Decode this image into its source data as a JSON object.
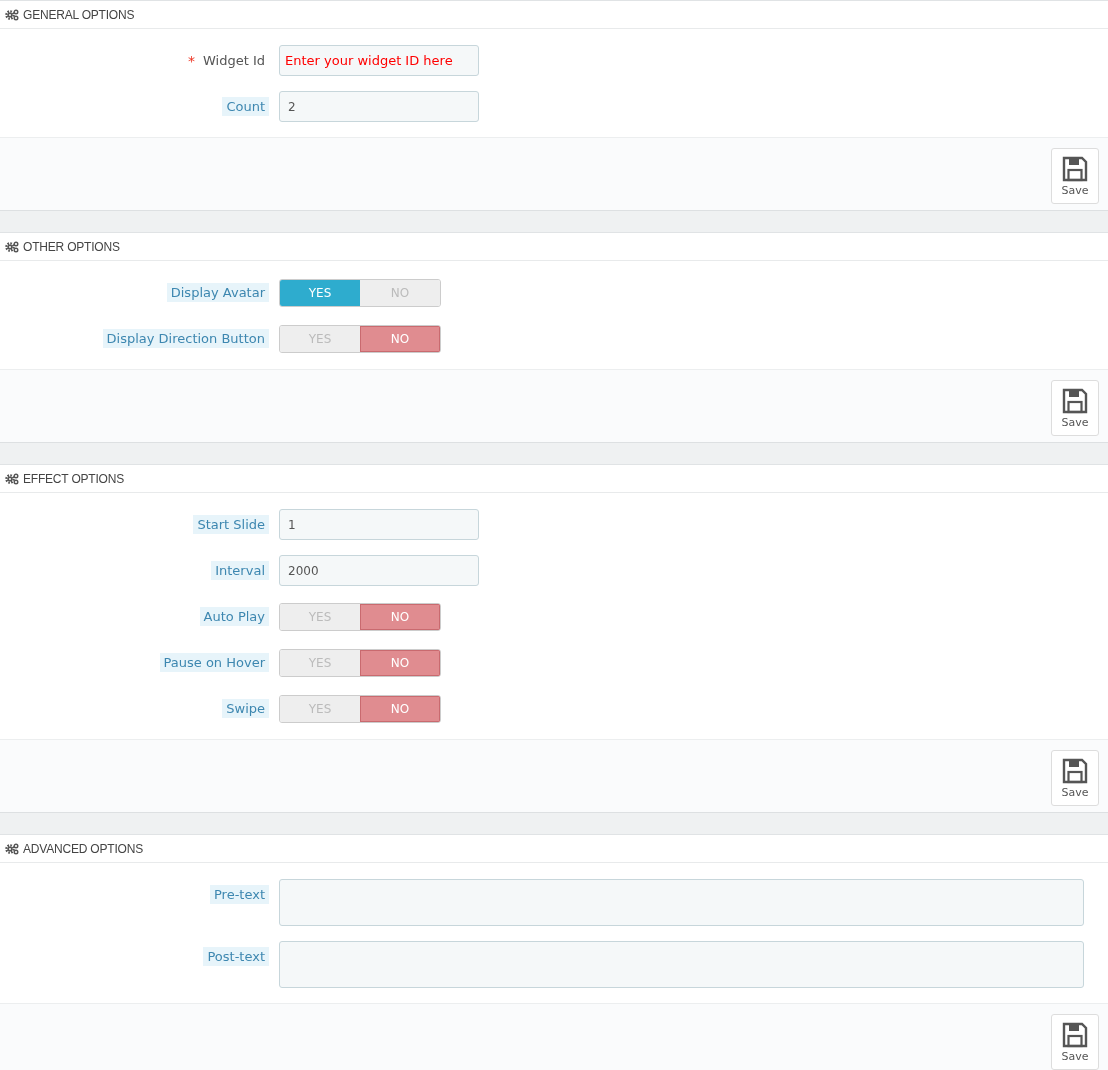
{
  "sections": [
    {
      "title": "GENERAL OPTIONS",
      "fields": [
        {
          "kind": "text",
          "label": "Widget Id",
          "required_mark": "*",
          "hint": false,
          "placeholder": "Enter your widget ID here"
        },
        {
          "kind": "text",
          "label": "Count",
          "hint": true,
          "value": "2"
        }
      ],
      "save": "Save"
    },
    {
      "title": "OTHER OPTIONS",
      "fields": [
        {
          "kind": "switch",
          "label": "Display Avatar",
          "hint": true,
          "options": [
            {
              "label": "YES",
              "selected": true
            },
            {
              "label": "NO",
              "selected": false
            }
          ]
        },
        {
          "kind": "switch",
          "label": "Display Direction Button",
          "hint": true,
          "options": [
            {
              "label": "YES",
              "selected": false
            },
            {
              "label": "NO",
              "selected": true
            }
          ]
        }
      ],
      "save": "Save"
    },
    {
      "title": "EFFECT OPTIONS",
      "fields": [
        {
          "kind": "text",
          "label": "Start Slide",
          "hint": true,
          "value": "1"
        },
        {
          "kind": "text",
          "label": "Interval",
          "hint": true,
          "value": "2000"
        },
        {
          "kind": "switch",
          "label": "Auto Play",
          "hint": true,
          "options": [
            {
              "label": "YES",
              "selected": false
            },
            {
              "label": "NO",
              "selected": true
            }
          ]
        },
        {
          "kind": "switch",
          "label": "Pause on Hover",
          "hint": true,
          "options": [
            {
              "label": "YES",
              "selected": false
            },
            {
              "label": "NO",
              "selected": true
            }
          ]
        },
        {
          "kind": "switch",
          "label": "Swipe",
          "hint": true,
          "options": [
            {
              "label": "YES",
              "selected": false
            },
            {
              "label": "NO",
              "selected": true
            }
          ]
        }
      ],
      "save": "Save"
    },
    {
      "title": "ADVANCED OPTIONS",
      "fields": [
        {
          "kind": "textarea",
          "label": "Pre-text",
          "hint": true
        },
        {
          "kind": "textarea",
          "label": "Post-text",
          "hint": true
        }
      ],
      "save": "Save"
    }
  ]
}
